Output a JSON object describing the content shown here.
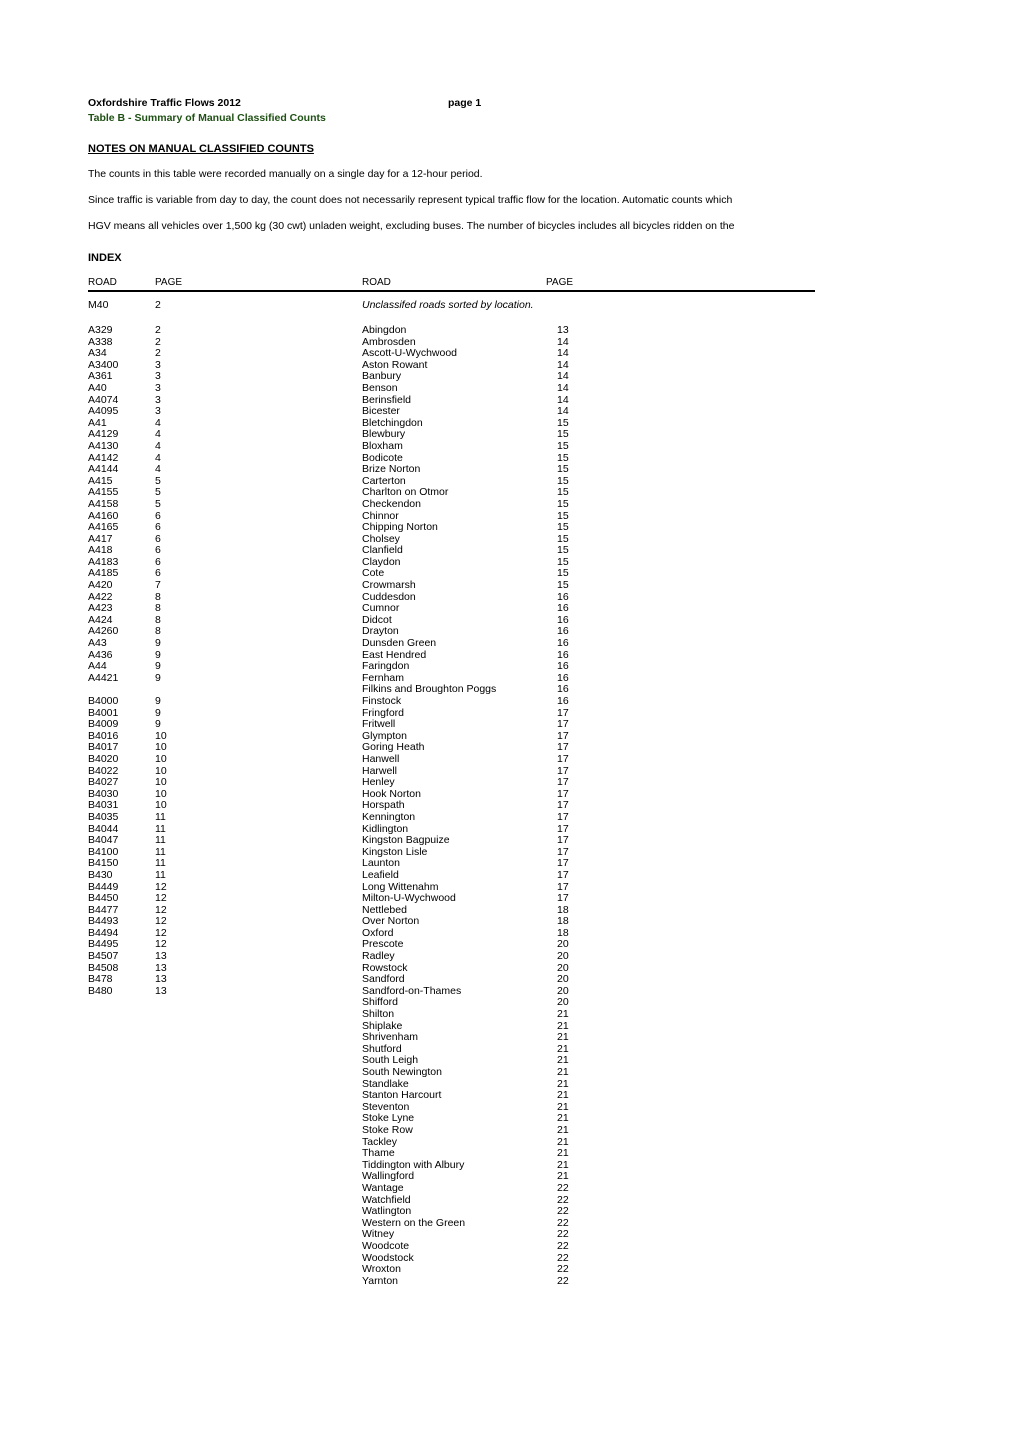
{
  "header": {
    "title": "Oxfordshire Traffic Flows 2012",
    "page_label": "page 1",
    "subtitle": "Table B - Summary of Manual Classified Counts"
  },
  "notes": {
    "heading": "NOTES ON MANUAL CLASSIFIED COUNTS",
    "line1": "The counts in this table were recorded manually on a single day for a 12-hour period.",
    "line2": "Since traffic is variable from day to day, the count does not necessarily represent typical traffic flow for the location. Automatic counts which",
    "line3": "HGV means all vehicles over 1,500 kg (30 cwt) unladen weight, excluding buses. The number of bicycles includes all bicycles ridden on the"
  },
  "index": {
    "title": "INDEX",
    "columns": {
      "road1": "ROAD",
      "page1": "PAGE",
      "road2": "ROAD",
      "page2": "PAGE"
    },
    "motorway": {
      "road": "M40",
      "page": "2"
    },
    "subnote": "Unclassifed roads sorted by location.",
    "roads": [
      {
        "name": "A329",
        "page": "2"
      },
      {
        "name": "A338",
        "page": "2"
      },
      {
        "name": "A34",
        "page": "2"
      },
      {
        "name": "A3400",
        "page": "3"
      },
      {
        "name": "A361",
        "page": "3"
      },
      {
        "name": "A40",
        "page": "3"
      },
      {
        "name": "A4074",
        "page": "3"
      },
      {
        "name": "A4095",
        "page": "3"
      },
      {
        "name": "A41",
        "page": "4"
      },
      {
        "name": "A4129",
        "page": "4"
      },
      {
        "name": "A4130",
        "page": "4"
      },
      {
        "name": "A4142",
        "page": "4"
      },
      {
        "name": "A4144",
        "page": "4"
      },
      {
        "name": "A415",
        "page": "5"
      },
      {
        "name": "A4155",
        "page": "5"
      },
      {
        "name": "A4158",
        "page": "5"
      },
      {
        "name": "A4160",
        "page": "6"
      },
      {
        "name": "A4165",
        "page": "6"
      },
      {
        "name": "A417",
        "page": "6"
      },
      {
        "name": "A418",
        "page": "6"
      },
      {
        "name": "A4183",
        "page": "6"
      },
      {
        "name": "A4185",
        "page": "6"
      },
      {
        "name": "A420",
        "page": "7"
      },
      {
        "name": "A422",
        "page": "8"
      },
      {
        "name": "A423",
        "page": "8"
      },
      {
        "name": "A424",
        "page": "8"
      },
      {
        "name": "A4260",
        "page": "8"
      },
      {
        "name": "A43",
        "page": "9"
      },
      {
        "name": "A436",
        "page": "9"
      },
      {
        "name": "A44",
        "page": "9"
      },
      {
        "name": "A4421",
        "page": "9"
      },
      {
        "name": "",
        "page": ""
      },
      {
        "name": "B4000",
        "page": "9"
      },
      {
        "name": "B4001",
        "page": "9"
      },
      {
        "name": "B4009",
        "page": "9"
      },
      {
        "name": "B4016",
        "page": "10"
      },
      {
        "name": "B4017",
        "page": "10"
      },
      {
        "name": "B4020",
        "page": "10"
      },
      {
        "name": "B4022",
        "page": "10"
      },
      {
        "name": "B4027",
        "page": "10"
      },
      {
        "name": "B4030",
        "page": "10"
      },
      {
        "name": "B4031",
        "page": "10"
      },
      {
        "name": "B4035",
        "page": "11"
      },
      {
        "name": "B4044",
        "page": "11"
      },
      {
        "name": "B4047",
        "page": "11"
      },
      {
        "name": "B4100",
        "page": "11"
      },
      {
        "name": "B4150",
        "page": "11"
      },
      {
        "name": "B430",
        "page": "11"
      },
      {
        "name": "B4449",
        "page": "12"
      },
      {
        "name": "B4450",
        "page": "12"
      },
      {
        "name": "B4477",
        "page": "12"
      },
      {
        "name": "B4493",
        "page": "12"
      },
      {
        "name": "B4494",
        "page": "12"
      },
      {
        "name": "B4495",
        "page": "12"
      },
      {
        "name": "B4507",
        "page": "13"
      },
      {
        "name": "B4508",
        "page": "13"
      },
      {
        "name": "B478",
        "page": "13"
      },
      {
        "name": "B480",
        "page": "13"
      }
    ],
    "locations": [
      {
        "name": "Abingdon",
        "page": "13"
      },
      {
        "name": "Ambrosden",
        "page": "14"
      },
      {
        "name": "Ascott-U-Wychwood",
        "page": "14"
      },
      {
        "name": "Aston Rowant",
        "page": "14"
      },
      {
        "name": "Banbury",
        "page": "14"
      },
      {
        "name": "Benson",
        "page": "14"
      },
      {
        "name": "Berinsfield",
        "page": "14"
      },
      {
        "name": "Bicester",
        "page": "14"
      },
      {
        "name": "Bletchingdon",
        "page": "15"
      },
      {
        "name": "Blewbury",
        "page": "15"
      },
      {
        "name": "Bloxham",
        "page": "15"
      },
      {
        "name": "Bodicote",
        "page": "15"
      },
      {
        "name": "Brize Norton",
        "page": "15"
      },
      {
        "name": "Carterton",
        "page": "15"
      },
      {
        "name": "Charlton on Otmor",
        "page": "15"
      },
      {
        "name": "Checkendon",
        "page": "15"
      },
      {
        "name": "Chinnor",
        "page": "15"
      },
      {
        "name": "Chipping Norton",
        "page": "15"
      },
      {
        "name": "Cholsey",
        "page": "15"
      },
      {
        "name": "Clanfield",
        "page": "15"
      },
      {
        "name": "Claydon",
        "page": "15"
      },
      {
        "name": "Cote",
        "page": "15"
      },
      {
        "name": "Crowmarsh",
        "page": "15"
      },
      {
        "name": "Cuddesdon",
        "page": "16"
      },
      {
        "name": "Cumnor",
        "page": "16"
      },
      {
        "name": "Didcot",
        "page": "16"
      },
      {
        "name": "Drayton",
        "page": "16"
      },
      {
        "name": "Dunsden Green",
        "page": "16"
      },
      {
        "name": "East Hendred",
        "page": "16"
      },
      {
        "name": "Faringdon",
        "page": "16"
      },
      {
        "name": "Fernham",
        "page": "16"
      },
      {
        "name": "Filkins and Broughton Poggs",
        "page": "16"
      },
      {
        "name": "Finstock",
        "page": "16"
      },
      {
        "name": "Fringford",
        "page": "17"
      },
      {
        "name": "Fritwell",
        "page": "17"
      },
      {
        "name": "Glympton",
        "page": "17"
      },
      {
        "name": "Goring Heath",
        "page": "17"
      },
      {
        "name": "Hanwell",
        "page": "17"
      },
      {
        "name": "Harwell",
        "page": "17"
      },
      {
        "name": "Henley",
        "page": "17"
      },
      {
        "name": "Hook Norton",
        "page": "17"
      },
      {
        "name": "Horspath",
        "page": "17"
      },
      {
        "name": "Kennington",
        "page": "17"
      },
      {
        "name": "Kidlington",
        "page": "17"
      },
      {
        "name": "Kingston Bagpuize",
        "page": "17"
      },
      {
        "name": "Kingston Lisle",
        "page": "17"
      },
      {
        "name": "Launton",
        "page": "17"
      },
      {
        "name": "Leafield",
        "page": "17"
      },
      {
        "name": "Long Wittenahm",
        "page": "17"
      },
      {
        "name": "Milton-U-Wychwood",
        "page": "17"
      },
      {
        "name": "Nettlebed",
        "page": "18"
      },
      {
        "name": "Over Norton",
        "page": "18"
      },
      {
        "name": "Oxford",
        "page": "18"
      },
      {
        "name": "Prescote",
        "page": "20"
      },
      {
        "name": "Radley",
        "page": "20"
      },
      {
        "name": "Rowstock",
        "page": "20"
      },
      {
        "name": "Sandford",
        "page": "20"
      },
      {
        "name": "Sandford-on-Thames",
        "page": "20"
      },
      {
        "name": "Shifford",
        "page": "20"
      },
      {
        "name": "Shilton",
        "page": "21"
      },
      {
        "name": "Shiplake",
        "page": "21"
      },
      {
        "name": "Shrivenham",
        "page": "21"
      },
      {
        "name": "Shutford",
        "page": "21"
      },
      {
        "name": "South Leigh",
        "page": "21"
      },
      {
        "name": "South Newington",
        "page": "21"
      },
      {
        "name": "Standlake",
        "page": "21"
      },
      {
        "name": "Stanton Harcourt",
        "page": "21"
      },
      {
        "name": "Steventon",
        "page": "21"
      },
      {
        "name": "Stoke Lyne",
        "page": "21"
      },
      {
        "name": "Stoke Row",
        "page": "21"
      },
      {
        "name": "Tackley",
        "page": "21"
      },
      {
        "name": "Thame",
        "page": "21"
      },
      {
        "name": "Tiddington with Albury",
        "page": "21"
      },
      {
        "name": "Wallingford",
        "page": "21"
      },
      {
        "name": "Wantage",
        "page": "22"
      },
      {
        "name": "Watchfield",
        "page": "22"
      },
      {
        "name": "Watlington",
        "page": "22"
      },
      {
        "name": "Western on the Green",
        "page": "22"
      },
      {
        "name": "Witney",
        "page": "22"
      },
      {
        "name": "Woodcote",
        "page": "22"
      },
      {
        "name": "Woodstock",
        "page": "22"
      },
      {
        "name": "Wroxton",
        "page": "22"
      },
      {
        "name": "Yarnton",
        "page": "22"
      }
    ]
  }
}
